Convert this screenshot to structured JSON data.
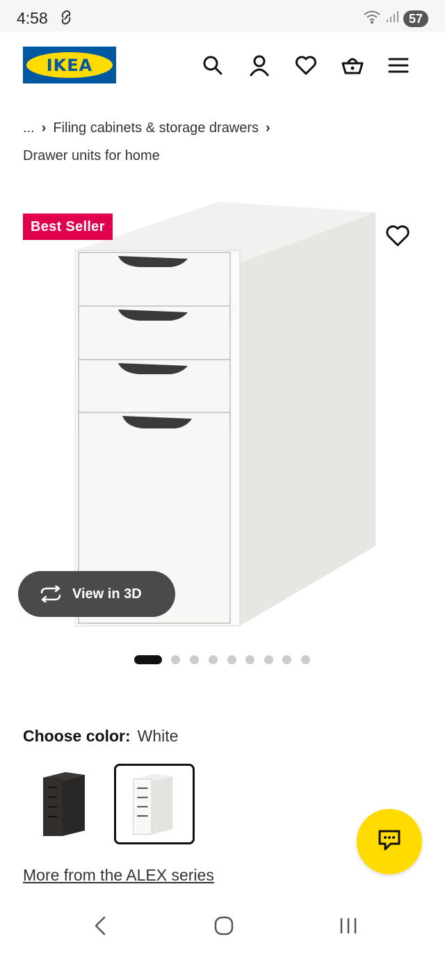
{
  "status": {
    "time": "4:58",
    "battery": "57"
  },
  "header": {
    "logo_text": "IKEA",
    "icons": [
      "search-icon",
      "account-icon",
      "heart-icon",
      "basket-icon",
      "menu-icon"
    ]
  },
  "breadcrumb": {
    "ellipsis": "...",
    "items": [
      "Filing cabinets & storage drawers",
      "Drawer units for home"
    ]
  },
  "product": {
    "badge": "Best Seller",
    "view3d_label": "View in 3D",
    "image_count": 9,
    "active_image": 1
  },
  "color": {
    "label": "Choose color:",
    "value": "White",
    "options": [
      "Black-brown",
      "White"
    ],
    "selected": "White"
  },
  "series_link": "More from the ALEX series",
  "colors": {
    "ikea_blue": "#0058a3",
    "ikea_yellow": "#ffdb00",
    "badge_red": "#e0004d"
  }
}
